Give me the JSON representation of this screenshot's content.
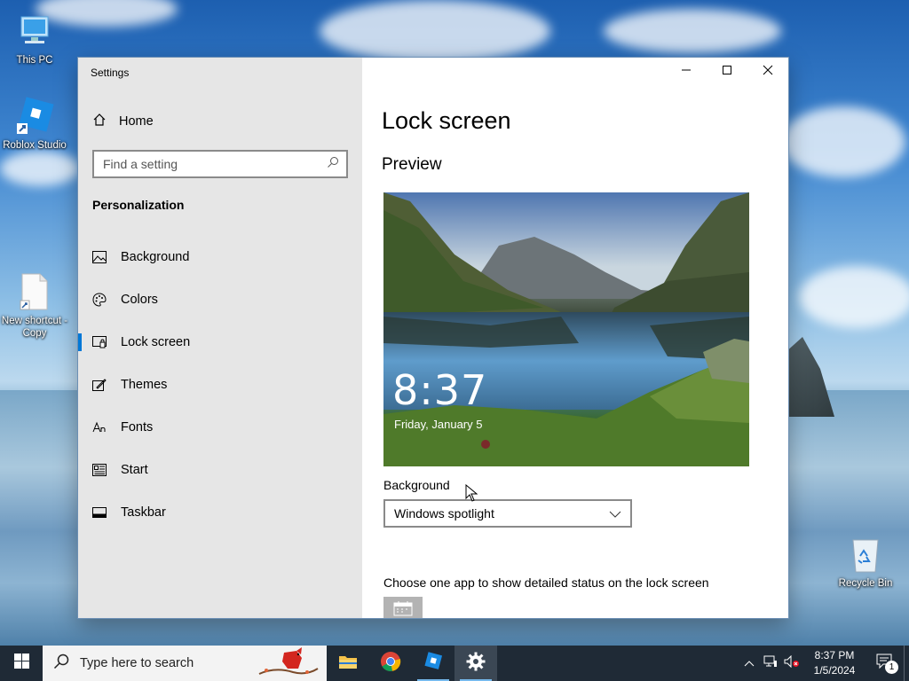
{
  "desktop": {
    "icons": [
      {
        "label": "This PC"
      },
      {
        "label": "Roblox Studio"
      },
      {
        "label": "New shortcut - Copy"
      },
      {
        "label": "Recycle Bin"
      }
    ]
  },
  "window": {
    "title": "Settings",
    "sidebar": {
      "home_label": "Home",
      "search_placeholder": "Find a setting",
      "section_title": "Personalization",
      "items": [
        {
          "label": "Background",
          "icon": "picture-icon"
        },
        {
          "label": "Colors",
          "icon": "palette-icon"
        },
        {
          "label": "Lock screen",
          "icon": "lock-screen-icon",
          "active": true
        },
        {
          "label": "Themes",
          "icon": "themes-icon"
        },
        {
          "label": "Fonts",
          "icon": "fonts-icon"
        },
        {
          "label": "Start",
          "icon": "start-icon"
        },
        {
          "label": "Taskbar",
          "icon": "taskbar-icon"
        }
      ]
    },
    "main": {
      "page_title": "Lock screen",
      "preview_heading": "Preview",
      "preview_time": "8:37",
      "preview_date": "Friday, January 5",
      "background_label": "Background",
      "background_value": "Windows spotlight",
      "status_label": "Choose one app to show detailed status on the lock screen"
    }
  },
  "taskbar": {
    "search_placeholder": "Type here to search",
    "clock_time": "8:37 PM",
    "clock_date": "1/5/2024",
    "notification_count": "1",
    "accent_color": "#0078d7"
  }
}
